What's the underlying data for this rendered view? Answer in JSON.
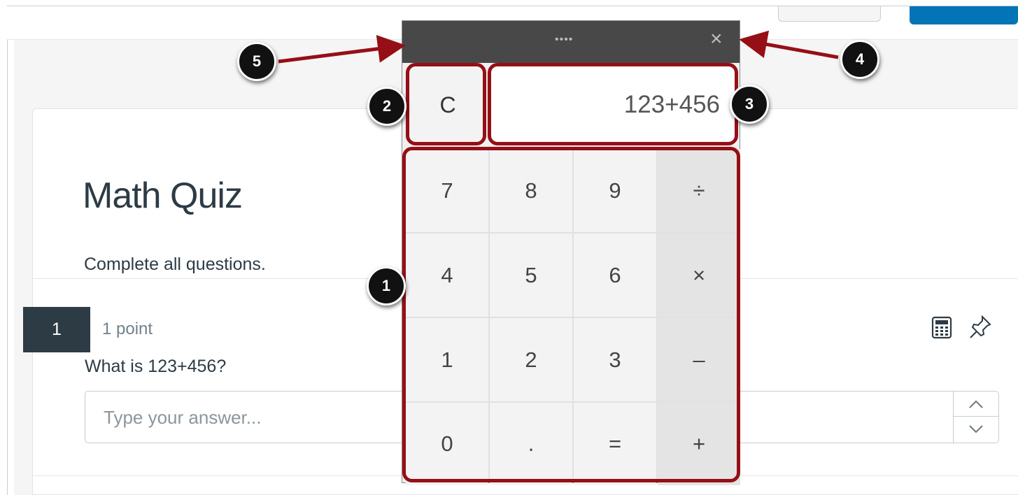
{
  "quiz": {
    "title": "Math Quiz",
    "instructions": "Complete all questions."
  },
  "question": {
    "number": "1",
    "points": "1 point",
    "text": "What is 123+456?",
    "answer_placeholder": "Type your answer...",
    "answer_value": ""
  },
  "toolbar_icons": [
    "calculator-icon",
    "pin-icon"
  ],
  "calculator": {
    "drag_handle": "••••",
    "close_label": "×",
    "clear_label": "C",
    "display_value": "123+456",
    "keys": [
      [
        "7",
        "8",
        "9",
        "÷"
      ],
      [
        "4",
        "5",
        "6",
        "×"
      ],
      [
        "1",
        "2",
        "3",
        "–"
      ],
      [
        "0",
        ".",
        "=",
        "+"
      ]
    ]
  },
  "callouts": [
    "1",
    "2",
    "3",
    "4",
    "5"
  ],
  "colors": {
    "highlight": "#960f16",
    "header": "#484848",
    "question_number_bg": "#2d3b45",
    "primary_button": "#0374b5"
  }
}
